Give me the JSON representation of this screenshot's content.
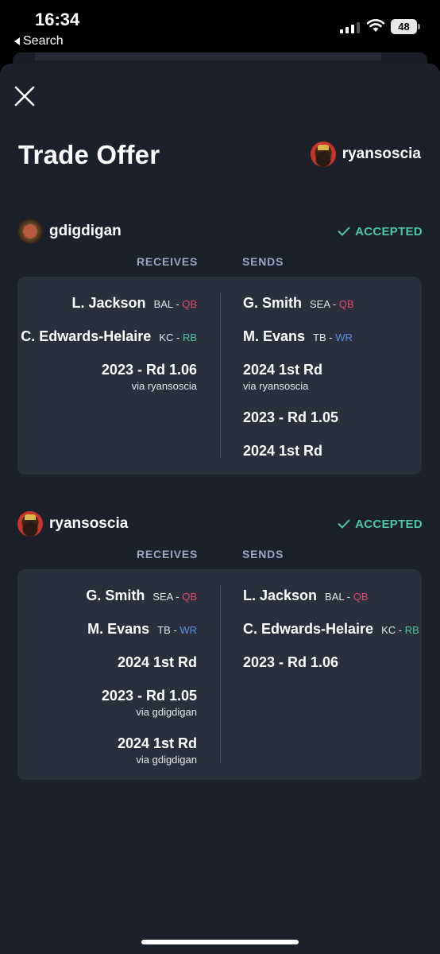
{
  "status_bar": {
    "time": "16:34",
    "back_label": "Search",
    "battery": "48"
  },
  "modal": {
    "title": "Trade Offer",
    "owner": "ryansoscia",
    "sides": [
      {
        "team": "gdigdigan",
        "status": "ACCEPTED",
        "receives_label": "RECEIVES",
        "sends_label": "SENDS",
        "receives": [
          {
            "name": "L. Jackson",
            "team": "BAL",
            "sep": " - ",
            "pos": "QB",
            "via": ""
          },
          {
            "name": "C. Edwards-Helaire",
            "team": "KC",
            "sep": " - ",
            "pos": "RB",
            "via": ""
          },
          {
            "name": "2023 - Rd 1.06",
            "team": "",
            "sep": "",
            "pos": "",
            "via": "via ryansoscia"
          }
        ],
        "sends": [
          {
            "name": "G. Smith",
            "team": "SEA",
            "sep": " - ",
            "pos": "QB",
            "via": ""
          },
          {
            "name": "M. Evans",
            "team": "TB",
            "sep": " - ",
            "pos": "WR",
            "via": ""
          },
          {
            "name": "2024 1st Rd",
            "team": "",
            "sep": "",
            "pos": "",
            "via": "via ryansoscia"
          },
          {
            "name": "2023 - Rd 1.05",
            "team": "",
            "sep": "",
            "pos": "",
            "via": ""
          },
          {
            "name": "2024 1st Rd",
            "team": "",
            "sep": "",
            "pos": "",
            "via": ""
          }
        ]
      },
      {
        "team": "ryansoscia",
        "status": "ACCEPTED",
        "receives_label": "RECEIVES",
        "sends_label": "SENDS",
        "receives": [
          {
            "name": "G. Smith",
            "team": "SEA",
            "sep": " - ",
            "pos": "QB",
            "via": ""
          },
          {
            "name": "M. Evans",
            "team": "TB",
            "sep": " - ",
            "pos": "WR",
            "via": ""
          },
          {
            "name": "2024 1st Rd",
            "team": "",
            "sep": "",
            "pos": "",
            "via": ""
          },
          {
            "name": "2023 - Rd 1.05",
            "team": "",
            "sep": "",
            "pos": "",
            "via": "via gdigdigan"
          },
          {
            "name": "2024 1st Rd",
            "team": "",
            "sep": "",
            "pos": "",
            "via": "via gdigdigan"
          }
        ],
        "sends": [
          {
            "name": "L. Jackson",
            "team": "BAL",
            "sep": " - ",
            "pos": "QB",
            "via": ""
          },
          {
            "name": "C. Edwards-Helaire",
            "team": "KC",
            "sep": " - ",
            "pos": "RB",
            "via": ""
          },
          {
            "name": "2023 - Rd 1.06",
            "team": "",
            "sep": "",
            "pos": "",
            "via": ""
          }
        ]
      }
    ]
  },
  "colors": {
    "background": "#1c202b",
    "card": "#2a2f3d",
    "accepted": "#4fc6a6",
    "qb": "#e0476a",
    "rb": "#4fc6a6",
    "wr": "#5b8fe6",
    "column_header": "#9aa6c4"
  },
  "icons": {
    "close": "close-icon",
    "accepted": "check-icon",
    "back": "back-triangle-icon",
    "signal": "signal-icon",
    "wifi": "wifi-icon"
  }
}
